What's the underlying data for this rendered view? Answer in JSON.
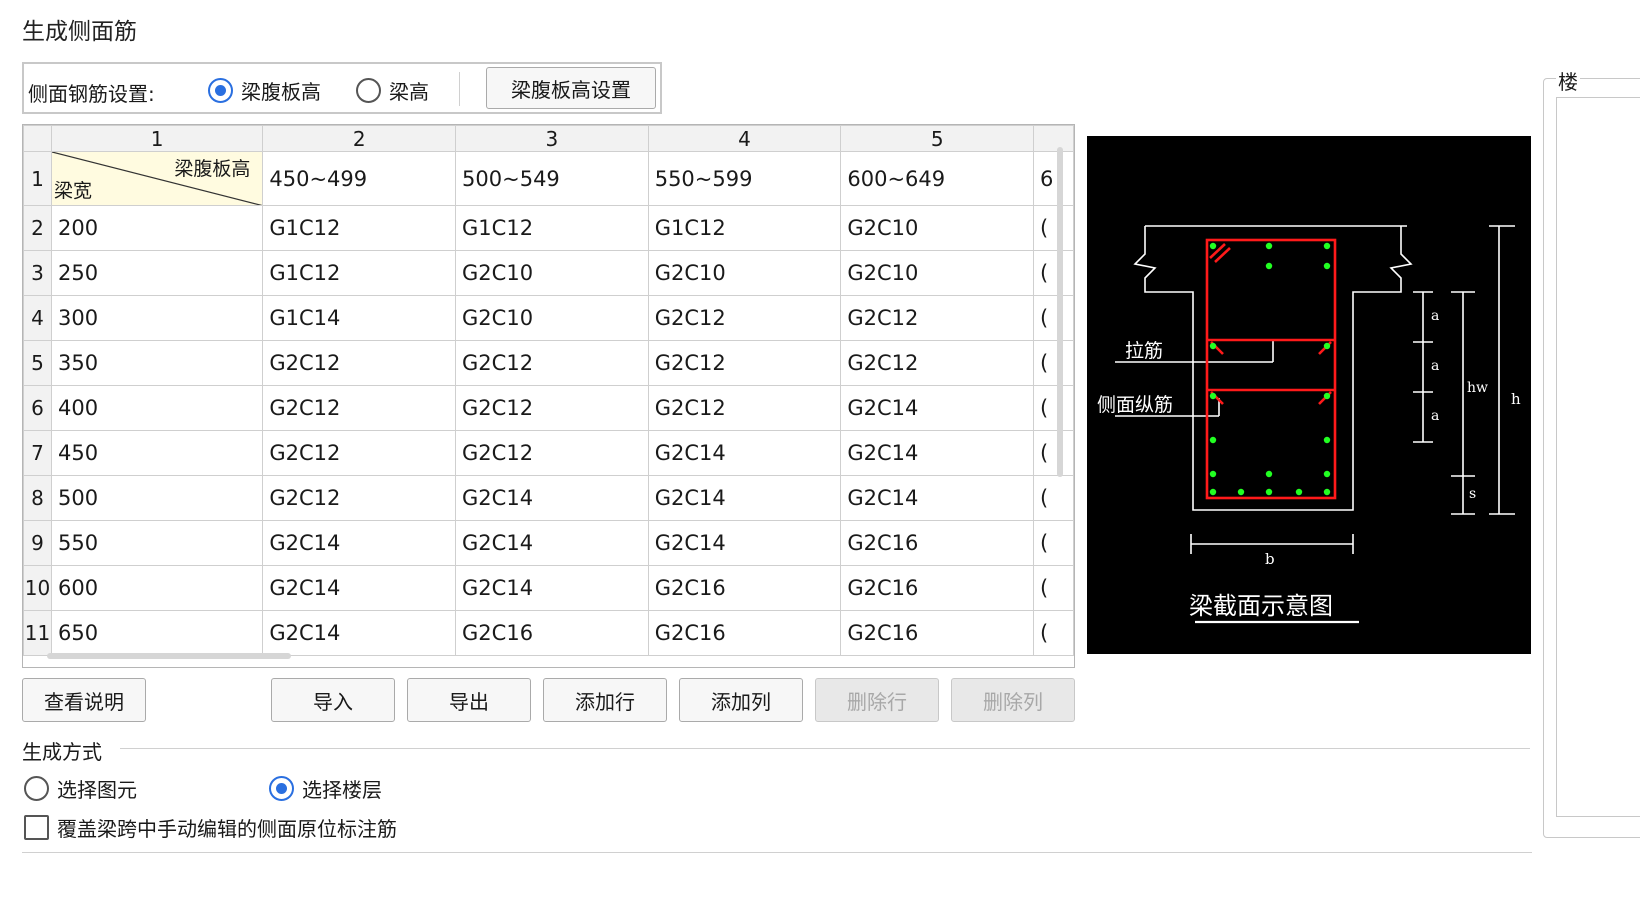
{
  "window": {
    "title": "生成侧面筋"
  },
  "settings": {
    "label": "侧面钢筋设置:",
    "option_web_height": "梁腹板高",
    "option_beam_height": "梁高",
    "selected": "梁腹板高",
    "config_button": "梁腹板高设置"
  },
  "grid": {
    "col_headers": [
      "1",
      "2",
      "3",
      "4",
      "5"
    ],
    "corner_top": "梁腹板高",
    "corner_bottom": "梁宽",
    "header_row_number": "1",
    "web_heights": [
      "450~499",
      "500~549",
      "550~599",
      "600~649",
      "6"
    ],
    "rows": [
      {
        "num": "2",
        "width": "200",
        "cells": [
          "G1C12",
          "G1C12",
          "G1C12",
          "G2C10",
          "("
        ]
      },
      {
        "num": "3",
        "width": "250",
        "cells": [
          "G1C12",
          "G2C10",
          "G2C10",
          "G2C10",
          "("
        ]
      },
      {
        "num": "4",
        "width": "300",
        "cells": [
          "G1C14",
          "G2C10",
          "G2C12",
          "G2C12",
          "("
        ]
      },
      {
        "num": "5",
        "width": "350",
        "cells": [
          "G2C12",
          "G2C12",
          "G2C12",
          "G2C12",
          "("
        ]
      },
      {
        "num": "6",
        "width": "400",
        "cells": [
          "G2C12",
          "G2C12",
          "G2C12",
          "G2C14",
          "("
        ]
      },
      {
        "num": "7",
        "width": "450",
        "cells": [
          "G2C12",
          "G2C12",
          "G2C14",
          "G2C14",
          "("
        ]
      },
      {
        "num": "8",
        "width": "500",
        "cells": [
          "G2C12",
          "G2C14",
          "G2C14",
          "G2C14",
          "("
        ]
      },
      {
        "num": "9",
        "width": "550",
        "cells": [
          "G2C14",
          "G2C14",
          "G2C14",
          "G2C16",
          "("
        ]
      },
      {
        "num": "10",
        "width": "600",
        "cells": [
          "G2C14",
          "G2C14",
          "G2C16",
          "G2C16",
          "("
        ]
      },
      {
        "num": "11",
        "width": "650",
        "cells": [
          "G2C14",
          "G2C16",
          "G2C16",
          "G2C16",
          "("
        ]
      }
    ]
  },
  "diagram": {
    "caption": "梁截面示意图",
    "tie_bar_label": "拉筋",
    "side_bar_label": "侧面纵筋",
    "dim_a": "a",
    "dim_hw": "hw",
    "dim_h": "h",
    "dim_s": "s",
    "dim_b": "b"
  },
  "actions": {
    "view_help": "查看说明",
    "import": "导入",
    "export": "导出",
    "add_row": "添加行",
    "add_col": "添加列",
    "delete_row": "删除行",
    "delete_col": "删除列"
  },
  "generation": {
    "title": "生成方式",
    "option_select_element": "选择图元",
    "option_select_floor": "选择楼层",
    "selected": "选择楼层",
    "override_checkbox": "覆盖梁跨中手动编辑的侧面原位标注筋",
    "override_checked": false
  },
  "right_panel": {
    "title_fragment": "楼"
  }
}
